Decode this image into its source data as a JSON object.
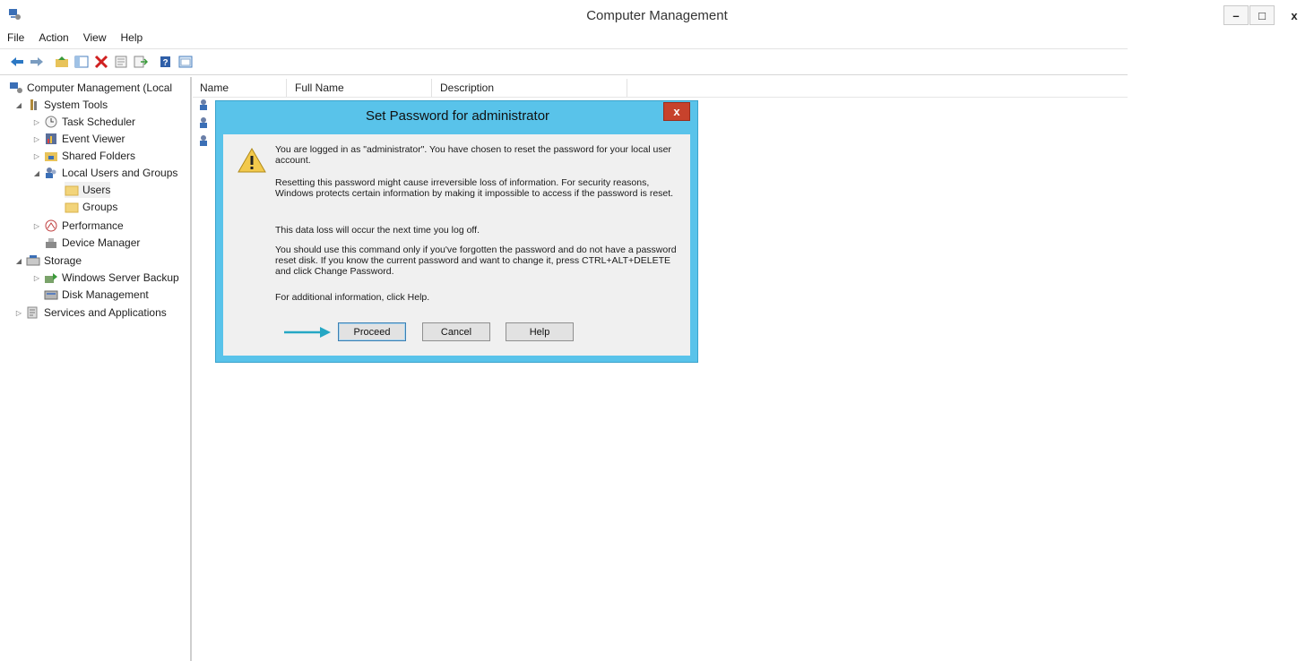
{
  "window": {
    "title": "Computer Management",
    "controls": {
      "minimize": "–",
      "restore": "□",
      "close": "x"
    }
  },
  "menubar": [
    "File",
    "Action",
    "View",
    "Help"
  ],
  "toolbar": [
    "back-arrow-icon",
    "forward-arrow-icon",
    "up-folder-icon",
    "show-hide-tree-icon",
    "delete-icon",
    "properties-icon",
    "export-list-icon",
    "help-icon",
    "console-icon"
  ],
  "tree": [
    {
      "label": "Computer Management (Local",
      "level": 0,
      "arrow": "",
      "icon": "computer-management-icon"
    },
    {
      "label": "System Tools",
      "level": 1,
      "arrow": "◢",
      "icon": "system-tools-icon"
    },
    {
      "label": "Task Scheduler",
      "level": 2,
      "arrow": "▷",
      "icon": "clock-icon"
    },
    {
      "label": "Event Viewer",
      "level": 2,
      "arrow": "▷",
      "icon": "event-viewer-icon"
    },
    {
      "label": "Shared Folders",
      "level": 2,
      "arrow": "▷",
      "icon": "shared-folder-icon"
    },
    {
      "label": "Local Users and Groups",
      "level": 2,
      "arrow": "◢",
      "icon": "users-group-icon"
    },
    {
      "label": "Users",
      "level": 3,
      "arrow": "",
      "icon": "folder-icon",
      "selected": true
    },
    {
      "label": "Groups",
      "level": 3,
      "arrow": "",
      "icon": "folder-icon"
    },
    {
      "label": "Performance",
      "level": 2,
      "arrow": "▷",
      "icon": "performance-icon"
    },
    {
      "label": "Device Manager",
      "level": 2,
      "arrow": "",
      "icon": "device-manager-icon"
    },
    {
      "label": "Storage",
      "level": 1,
      "arrow": "◢",
      "icon": "storage-icon"
    },
    {
      "label": "Windows Server Backup",
      "level": 2,
      "arrow": "▷",
      "icon": "backup-icon"
    },
    {
      "label": "Disk Management",
      "level": 2,
      "arrow": "",
      "icon": "disk-icon"
    },
    {
      "label": "Services and Applications",
      "level": 1,
      "arrow": "▷",
      "icon": "services-icon"
    }
  ],
  "list": {
    "columns": [
      "Name",
      "Full Name",
      "Description"
    ],
    "rows": 3
  },
  "dialog": {
    "title": "Set Password for administrator",
    "close_label": "x",
    "paragraphs": [
      "You are logged in as \"administrator\". You have chosen to reset the password for your local user account.",
      "Resetting this password might cause irreversible loss of information. For security reasons, Windows protects certain information by making it impossible to access if the password is reset.",
      "This data loss will occur the next time you log off.",
      "You should use this command only if you've forgotten the password and do not have a password reset disk. If you know the current password and want to change it, press CTRL+ALT+DELETE and click Change Password.",
      "For additional information, click Help."
    ],
    "buttons": {
      "proceed": "Proceed",
      "cancel": "Cancel",
      "help": "Help"
    }
  },
  "colors": {
    "dialog_frame": "#59c3ea",
    "close_button": "#c7422c",
    "annotation_arrow": "#25a7c4"
  }
}
